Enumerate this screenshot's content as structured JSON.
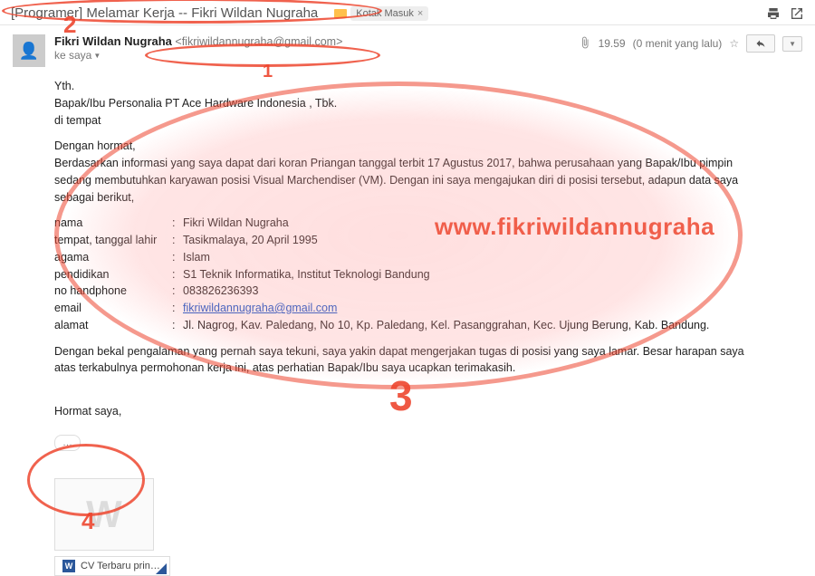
{
  "header": {
    "subject": "[Programer] Melamar Kerja -- Fikri Wildan Nugraha",
    "inbox_label": "Kotak Masuk"
  },
  "sender": {
    "name": "Fikri Wildan Nugraha",
    "email": "<fikriwildannugraha@gmail.com>",
    "to_line": "ke saya"
  },
  "meta": {
    "time": "19.59",
    "ago": "(0 menit yang lalu)"
  },
  "body": {
    "salut1": "Yth.",
    "salut2": "Bapak/Ibu Personalia PT Ace Hardware Indonesia , Tbk.",
    "salut3": "di tempat",
    "open": "Dengan hormat,",
    "para1": "Berdasarkan informasi yang saya dapat dari koran Priangan tanggal terbit 17 Agustus 2017, bahwa perusahaan yang Bapak/Ibu pimpin sedang membutuhkan karyawan posisi Visual Marchendiser (VM). Dengan ini saya mengajukan diri di posisi tersebut, adapun data saya sebagai berikut,",
    "kv": [
      {
        "k": "nama",
        "v": "Fikri Wildan Nugraha"
      },
      {
        "k": "tempat, tanggal lahir",
        "v": "Tasikmalaya, 20  April 1995"
      },
      {
        "k": "agama",
        "v": "Islam"
      },
      {
        "k": "pendidikan",
        "v": "S1 Teknik Informatika, Institut Teknologi Bandung"
      },
      {
        "k": "no handphone",
        "v": "083826236393"
      },
      {
        "k": "email",
        "v": "fikriwildannugraha@gmail.com",
        "link": true
      },
      {
        "k": "alamat",
        "v": "Jl. Nagrog, Kav. Paledang, No 10, Kp. Paledang, Kel. Pasanggrahan, Kec. Ujung Berung, Kab. Bandung."
      }
    ],
    "para2": "Dengan bekal pengalaman yang pernah saya tekuni, saya yakin dapat mengerjakan tugas di posisi yang saya lamar. Besar harapan saya atas terkabulnya permohonan kerja ini, atas perhatian Bapak/Ibu saya ucapkan terimakasih.",
    "closing": "Hormat saya,",
    "trimmed": "…"
  },
  "attachment": {
    "thumb_letter": "W",
    "filename": "CV Terbaru print…"
  },
  "annotations": {
    "n1": "1",
    "n2": "2",
    "n3": "3",
    "n4": "4",
    "watermark": "www.fikriwildannugraha"
  }
}
